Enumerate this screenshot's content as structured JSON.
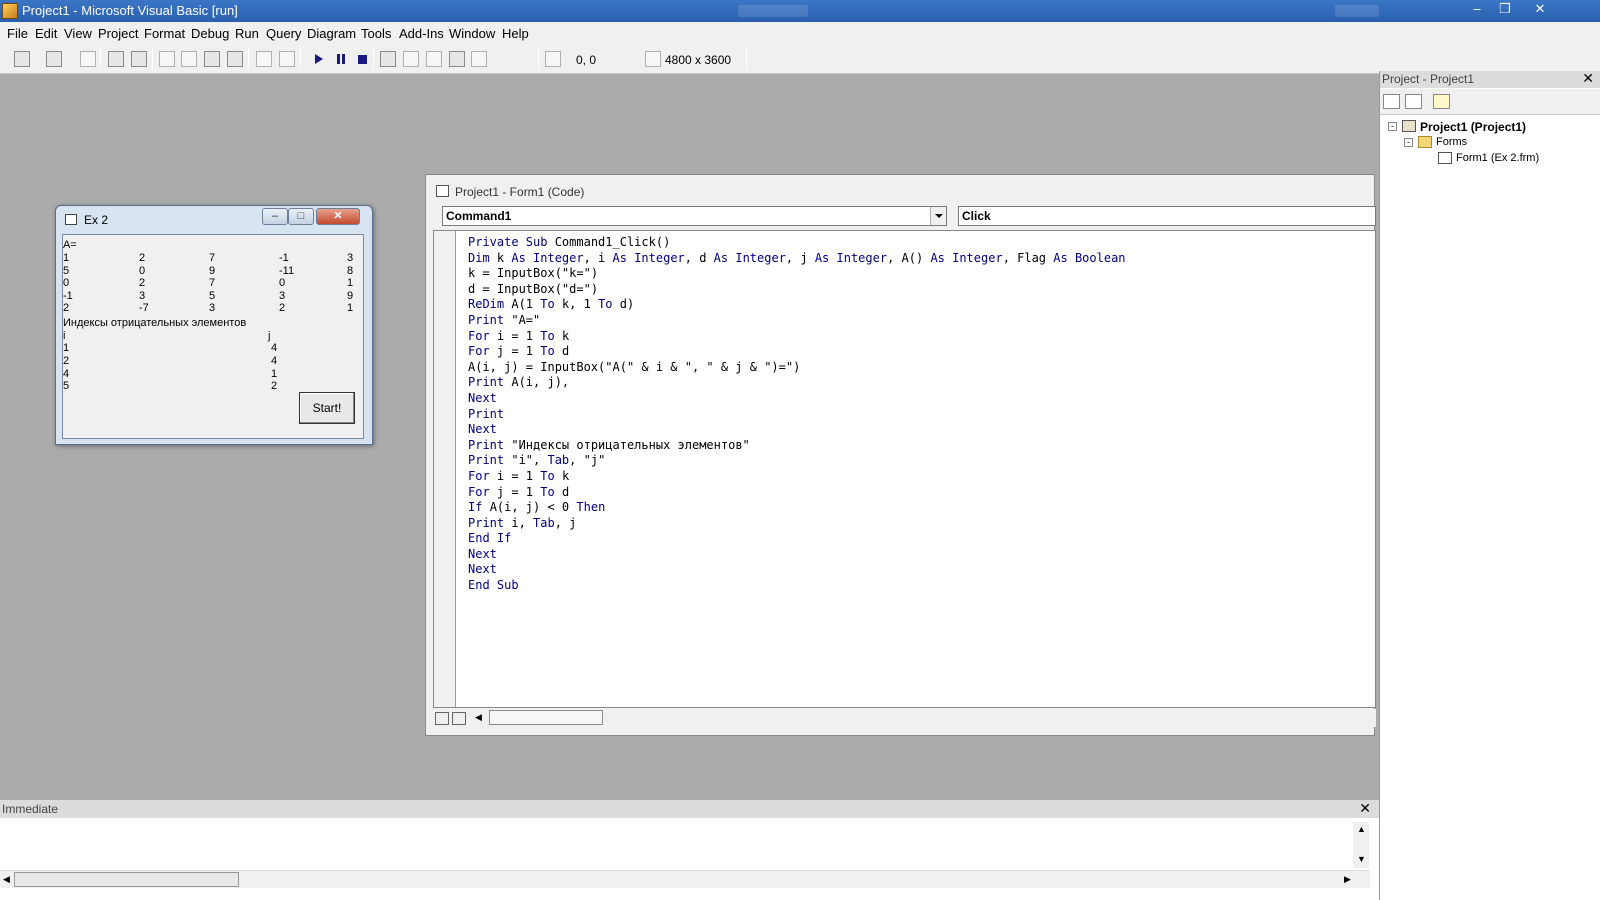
{
  "window": {
    "title": "Project1 - Microsoft Visual Basic [run]"
  },
  "menu": [
    "File",
    "Edit",
    "View",
    "Project",
    "Format",
    "Debug",
    "Run",
    "Query",
    "Diagram",
    "Tools",
    "Add-Ins",
    "Window",
    "Help"
  ],
  "toolbar": {
    "position": "0, 0",
    "size": "4800 x 3600"
  },
  "form_window": {
    "title": "Ex 2",
    "output": {
      "header": "A=",
      "matrix": [
        [
          "1",
          "2",
          "7",
          "-1",
          "3"
        ],
        [
          "5",
          "0",
          "9",
          "-11",
          "8"
        ],
        [
          "0",
          "2",
          "7",
          "0",
          "1"
        ],
        [
          "-1",
          "3",
          "5",
          "3",
          "9"
        ],
        [
          "2",
          "-7",
          "3",
          "2",
          "1"
        ]
      ],
      "caption": "Индексы отрицательных элементов",
      "index_header": [
        "i",
        "j"
      ],
      "indices": [
        [
          "1",
          "4"
        ],
        [
          "2",
          "4"
        ],
        [
          "4",
          "1"
        ],
        [
          "5",
          "2"
        ]
      ]
    },
    "start_button": "Start!"
  },
  "code_window": {
    "title": "Project1 - Form1 (Code)",
    "object_combo": "Command1",
    "procedure_combo": "Click",
    "lines": [
      [
        {
          "t": "Private Sub ",
          "k": true
        },
        {
          "t": "Command1_Click()",
          "k": false
        }
      ],
      [
        {
          "t": "Dim ",
          "k": true
        },
        {
          "t": "k ",
          "k": false
        },
        {
          "t": "As Integer",
          "k": true
        },
        {
          "t": ", i ",
          "k": false
        },
        {
          "t": "As Integer",
          "k": true
        },
        {
          "t": ", d ",
          "k": false
        },
        {
          "t": "As Integer",
          "k": true
        },
        {
          "t": ", j ",
          "k": false
        },
        {
          "t": "As Integer",
          "k": true
        },
        {
          "t": ", A() ",
          "k": false
        },
        {
          "t": "As Integer",
          "k": true
        },
        {
          "t": ", Flag ",
          "k": false
        },
        {
          "t": "As Boolean",
          "k": true
        }
      ],
      [
        {
          "t": "k = InputBox(\"k=\")",
          "k": false
        }
      ],
      [
        {
          "t": "d = InputBox(\"d=\")",
          "k": false
        }
      ],
      [
        {
          "t": "ReDim ",
          "k": true
        },
        {
          "t": "A(1 ",
          "k": false
        },
        {
          "t": "To",
          "k": true
        },
        {
          "t": " k, 1 ",
          "k": false
        },
        {
          "t": "To",
          "k": true
        },
        {
          "t": " d)",
          "k": false
        }
      ],
      [
        {
          "t": "Print ",
          "k": true
        },
        {
          "t": "\"A=\"",
          "k": false
        }
      ],
      [
        {
          "t": "For ",
          "k": true
        },
        {
          "t": "i = 1 ",
          "k": false
        },
        {
          "t": "To",
          "k": true
        },
        {
          "t": " k",
          "k": false
        }
      ],
      [
        {
          "t": "For ",
          "k": true
        },
        {
          "t": "j = 1 ",
          "k": false
        },
        {
          "t": "To",
          "k": true
        },
        {
          "t": " d",
          "k": false
        }
      ],
      [
        {
          "t": "A(i, j) = InputBox(\"A(\" & i & \", \" & j & \")=\")",
          "k": false
        }
      ],
      [
        {
          "t": "Print ",
          "k": true
        },
        {
          "t": "A(i, j),",
          "k": false
        }
      ],
      [
        {
          "t": "Next",
          "k": true
        }
      ],
      [
        {
          "t": "Print",
          "k": true
        }
      ],
      [
        {
          "t": "Next",
          "k": true
        }
      ],
      [
        {
          "t": "Print ",
          "k": true
        },
        {
          "t": "\"Индексы отрицательных элементов\"",
          "k": false
        }
      ],
      [
        {
          "t": "Print ",
          "k": true
        },
        {
          "t": "\"i\", ",
          "k": false
        },
        {
          "t": "Tab",
          "k": true
        },
        {
          "t": ", \"j\"",
          "k": false
        }
      ],
      [
        {
          "t": "For ",
          "k": true
        },
        {
          "t": "i = 1 ",
          "k": false
        },
        {
          "t": "To",
          "k": true
        },
        {
          "t": " k",
          "k": false
        }
      ],
      [
        {
          "t": "For ",
          "k": true
        },
        {
          "t": "j = 1 ",
          "k": false
        },
        {
          "t": "To",
          "k": true
        },
        {
          "t": " d",
          "k": false
        }
      ],
      [
        {
          "t": "If ",
          "k": true
        },
        {
          "t": "A(i, j) < 0 ",
          "k": false
        },
        {
          "t": "Then",
          "k": true
        }
      ],
      [
        {
          "t": "Print ",
          "k": true
        },
        {
          "t": "i, ",
          "k": false
        },
        {
          "t": "Tab",
          "k": true
        },
        {
          "t": ", j",
          "k": false
        }
      ],
      [
        {
          "t": "End If",
          "k": true
        }
      ],
      [
        {
          "t": "Next",
          "k": true
        }
      ],
      [
        {
          "t": "Next",
          "k": true
        }
      ],
      [
        {
          "t": "End Sub",
          "k": true
        }
      ]
    ]
  },
  "project_explorer": {
    "title": "Project - Project1",
    "root": "Project1 (Project1)",
    "folder": "Forms",
    "item": "Form1 (Ex 2.frm)"
  },
  "immediate": {
    "title": "Immediate"
  },
  "colors": {
    "keyword": "#00007f",
    "titlebar": "#2a5fb0",
    "background": "#ababab"
  }
}
